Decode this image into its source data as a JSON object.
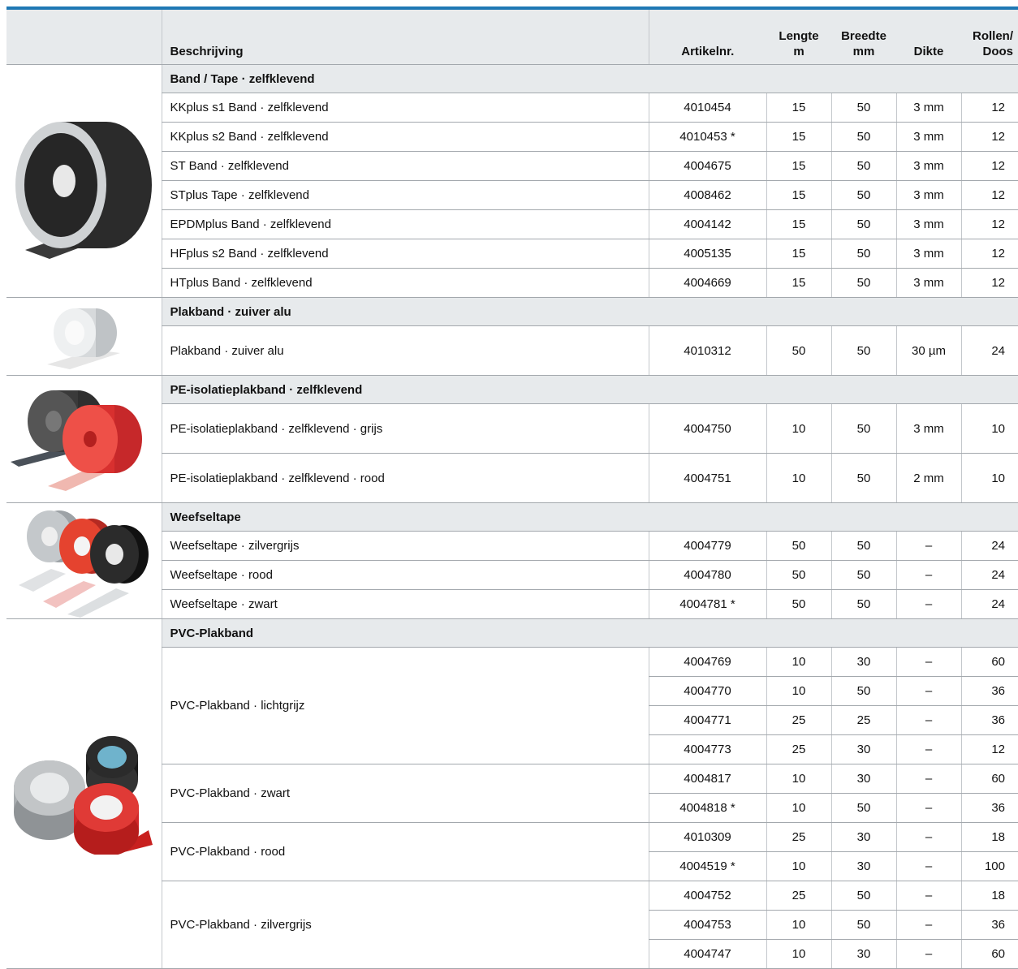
{
  "header": {
    "beschrijving": "Beschrijving",
    "artikelnr": "Artikelnr.",
    "lengte_1": "Lengte",
    "lengte_2": "m",
    "breedte_1": "Breedte",
    "breedte_2": "mm",
    "dikte": "Dikte",
    "rollen_1": "Rollen/",
    "rollen_2": "Doos"
  },
  "groups": [
    {
      "category": "Band / Tape · zelfklevend",
      "image": "black-foam-tape-roll-icon",
      "rows": [
        {
          "desc": "KKplus s1 Band · zelfklevend",
          "art": "4010454",
          "lengte": "15",
          "breedte": "50",
          "dikte": "3 mm",
          "rollen": "12"
        },
        {
          "desc": "KKplus s2 Band · zelfklevend",
          "art": "4010453 *",
          "lengte": "15",
          "breedte": "50",
          "dikte": "3 mm",
          "rollen": "12"
        },
        {
          "desc": "ST Band · zelfklevend",
          "art": "4004675",
          "lengte": "15",
          "breedte": "50",
          "dikte": "3 mm",
          "rollen": "12"
        },
        {
          "desc": "STplus Tape · zelfklevend",
          "art": "4008462",
          "lengte": "15",
          "breedte": "50",
          "dikte": "3 mm",
          "rollen": "12"
        },
        {
          "desc": "EPDMplus Band · zelfklevend",
          "art": "4004142",
          "lengte": "15",
          "breedte": "50",
          "dikte": "3 mm",
          "rollen": "12"
        },
        {
          "desc": "HFplus s2 Band · zelfklevend",
          "art": "4005135",
          "lengte": "15",
          "breedte": "50",
          "dikte": "3 mm",
          "rollen": "12"
        },
        {
          "desc": "HTplus Band · zelfklevend",
          "art": "4004669",
          "lengte": "15",
          "breedte": "50",
          "dikte": "3 mm",
          "rollen": "12"
        }
      ]
    },
    {
      "category": "Plakband · zuiver alu",
      "image": "aluminium-tape-roll-icon",
      "rows": [
        {
          "desc": "Plakband · zuiver alu",
          "art": "4010312",
          "lengte": "50",
          "breedte": "50",
          "dikte": "30 µm",
          "rollen": "24"
        }
      ]
    },
    {
      "category": "PE-isolatieplakband · zelfklevend",
      "image": "pe-insulation-tape-rolls-icon",
      "rows": [
        {
          "desc": "PE-isolatieplakband · zelfklevend · grijs",
          "art": "4004750",
          "lengte": "10",
          "breedte": "50",
          "dikte": "3 mm",
          "rollen": "10"
        },
        {
          "desc": "PE-isolatieplakband · zelfklevend · rood",
          "art": "4004751",
          "lengte": "10",
          "breedte": "50",
          "dikte": "2 mm",
          "rollen": "10"
        }
      ]
    },
    {
      "category": "Weefseltape",
      "image": "fabric-tape-rolls-icon",
      "rows": [
        {
          "desc": "Weefseltape · zilvergrijs",
          "art": "4004779",
          "lengte": "50",
          "breedte": "50",
          "dikte": "–",
          "rollen": "24"
        },
        {
          "desc": "Weefseltape · rood",
          "art": "4004780",
          "lengte": "50",
          "breedte": "50",
          "dikte": "–",
          "rollen": "24"
        },
        {
          "desc": "Weefseltape · zwart",
          "art": "4004781 *",
          "lengte": "50",
          "breedte": "50",
          "dikte": "–",
          "rollen": "24"
        }
      ]
    },
    {
      "category": "PVC-Plakband",
      "image": "pvc-tape-rolls-icon",
      "subgroups": [
        {
          "desc": "PVC-Plakband · lichtgrijz",
          "rows": [
            {
              "art": "4004769",
              "lengte": "10",
              "breedte": "30",
              "dikte": "–",
              "rollen": "60"
            },
            {
              "art": "4004770",
              "lengte": "10",
              "breedte": "50",
              "dikte": "–",
              "rollen": "36"
            },
            {
              "art": "4004771",
              "lengte": "25",
              "breedte": "25",
              "dikte": "–",
              "rollen": "36"
            },
            {
              "art": "4004773",
              "lengte": "25",
              "breedte": "30",
              "dikte": "–",
              "rollen": "12"
            }
          ]
        },
        {
          "desc": "PVC-Plakband · zwart",
          "rows": [
            {
              "art": "4004817",
              "lengte": "10",
              "breedte": "30",
              "dikte": "–",
              "rollen": "60"
            },
            {
              "art": "4004818 *",
              "lengte": "10",
              "breedte": "50",
              "dikte": "–",
              "rollen": "36"
            }
          ]
        },
        {
          "desc": "PVC-Plakband · rood",
          "rows": [
            {
              "art": "4010309",
              "lengte": "25",
              "breedte": "30",
              "dikte": "–",
              "rollen": "18"
            },
            {
              "art": "4004519 *",
              "lengte": "10",
              "breedte": "30",
              "dikte": "–",
              "rollen": "100"
            }
          ]
        },
        {
          "desc": "PVC-Plakband · zilvergrijs",
          "rows": [
            {
              "art": "4004752",
              "lengte": "25",
              "breedte": "50",
              "dikte": "–",
              "rollen": "18"
            },
            {
              "art": "4004753",
              "lengte": "10",
              "breedte": "50",
              "dikte": "–",
              "rollen": "36"
            },
            {
              "art": "4004747",
              "lengte": "10",
              "breedte": "30",
              "dikte": "–",
              "rollen": "60"
            }
          ]
        }
      ]
    }
  ],
  "colors": {
    "accent": "#1f78b4",
    "header_bg": "#e7eaec",
    "rule": "#a3a8ad"
  }
}
